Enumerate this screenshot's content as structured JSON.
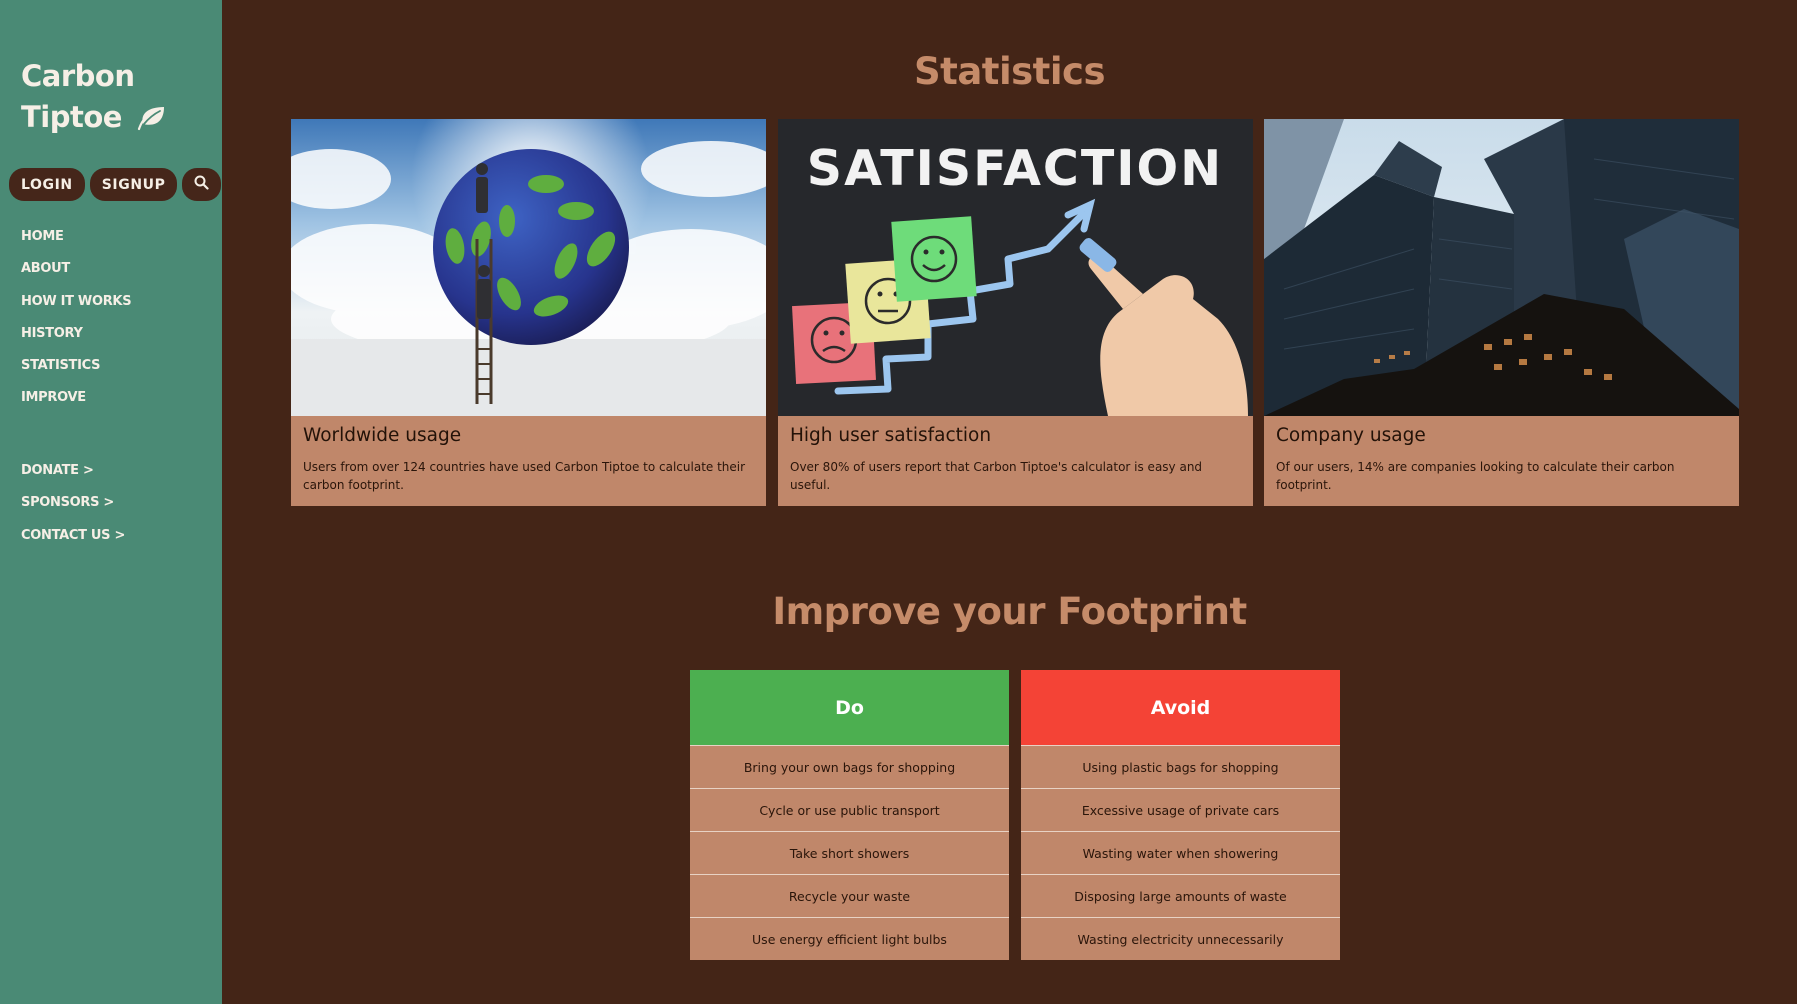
{
  "sidebar": {
    "brand_line1": "Carbon",
    "brand_line2": "Tiptoe",
    "brand_icon": "leaf-icon",
    "login_label": "LOGIN",
    "signup_label": "SIGNUP",
    "search_icon": "search-icon",
    "nav_primary": [
      "HOME",
      "ABOUT",
      "HOW IT WORKS",
      "HISTORY",
      "STATISTICS",
      "IMPROVE"
    ],
    "nav_secondary": [
      "DONATE >",
      "SPONSORS >",
      "CONTACT US >"
    ]
  },
  "statistics": {
    "heading": "Statistics",
    "cards": [
      {
        "image": "earth-footprints-ladder-image",
        "title": "Worldwide usage",
        "text": "Users from over 124 countries have used Carbon Tiptoe to calculate their carbon footprint."
      },
      {
        "image": "satisfaction-chalkboard-image",
        "image_text": "SATISFACTION",
        "title": "High user satisfaction",
        "text": "Over 80% of users report that Carbon Tiptoe's calculator is easy and useful."
      },
      {
        "image": "skyscrapers-image",
        "title": "Company usage",
        "text": "Of our users, 14% are companies looking to calculate their carbon footprint."
      }
    ]
  },
  "improve": {
    "heading": "Improve your Footprint",
    "do": {
      "label": "Do",
      "color": "#4caf50",
      "items": [
        "Bring your own bags for shopping",
        "Cycle or use public transport",
        "Take short showers",
        "Recycle your waste",
        "Use energy efficient light bulbs"
      ]
    },
    "avoid": {
      "label": "Avoid",
      "color": "#f44336",
      "items": [
        "Using plastic bags for shopping",
        "Excessive usage of private cars",
        "Wasting water when showering",
        "Disposing large amounts of waste",
        "Wasting electricity unnecessarily"
      ]
    }
  },
  "colors": {
    "sidebar_bg": "#4a8a75",
    "page_bg": "#442517",
    "accent": "#c58b69",
    "card_bg": "#c0876a"
  }
}
